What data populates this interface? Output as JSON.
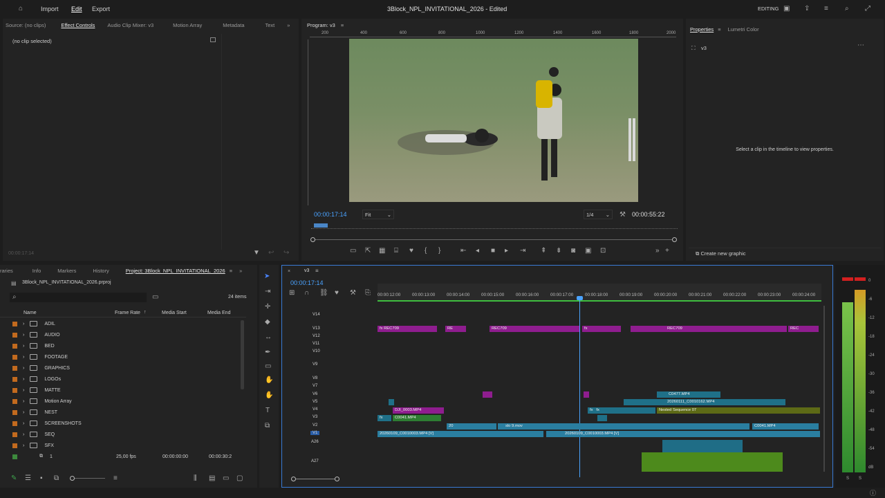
{
  "app": {
    "title": "3Block_NPL_INVITATIONAL_2026 - Edited",
    "menu": [
      "Import",
      "Edit",
      "Export"
    ],
    "mode": "EDITING"
  },
  "source_panel": {
    "tabs": [
      "Source: (no clips)",
      "Effect Controls",
      "Audio Clip Mixer: v3",
      "Motion Array",
      "Metadata",
      "Text"
    ],
    "no_clip": "(no clip selected)",
    "timecode": "00:00:17:14"
  },
  "program": {
    "tab": "Program: v3",
    "ruler": [
      "200",
      "400",
      "600",
      "800",
      "1000",
      "1200",
      "1400",
      "1600",
      "1800",
      "2000"
    ],
    "timecode": "00:00:17:14",
    "fit": "Fit",
    "quality": "1/4",
    "duration": "00:00:55:22"
  },
  "properties": {
    "tabs": [
      "Properties",
      "Lumetri Color"
    ],
    "sequence": "v3",
    "hint": "Select a clip in the timeline to view properties.",
    "create_button": "Create new graphic"
  },
  "project": {
    "tabs": [
      "raries",
      "Info",
      "Markers",
      "History",
      "Project: 3Block_NPL_INVITATIONAL_2026"
    ],
    "file": "3Block_NPL_INVITATIONAL_2026.prproj",
    "items": "24 items",
    "columns": [
      "Name",
      "Frame Rate",
      "Media Start",
      "Media End"
    ],
    "folders": [
      "ADIL",
      "AUDIO",
      "BED",
      "FOOTAGE",
      "GRAPHICS",
      "LOGOs",
      "MATTE",
      "Motion Array",
      "NEST",
      "SCREENSHOTS",
      "SEQ",
      "SFX"
    ],
    "seq_item": {
      "name": "1",
      "fps": "25,00 fps",
      "start": "00:00:00:00",
      "end": "00:00:30:2"
    }
  },
  "timeline": {
    "tab": "v3",
    "timecode": "00:00:17:14",
    "ruler": [
      "00:00:12:00",
      "00:00:13:00",
      "00:00:14:00",
      "00:00:15:00",
      "00:00:16:00",
      "00:00:17:00",
      "00:00:18:00",
      "00:00:19:00",
      "00:00:20:00",
      "00:00:21:00",
      "00:00:22:00",
      "00:00:23:00",
      "00:00:24:00"
    ],
    "tracks": [
      "V14",
      "V13",
      "V12",
      "V11",
      "V10",
      "V9",
      "V8",
      "V7",
      "V6",
      "V5",
      "V4",
      "V3",
      "V2",
      "V1",
      "A26",
      "A27"
    ],
    "clips": {
      "rec1": "REC709",
      "re": "RE",
      "rec2": "REC709",
      "rec3": "REC709",
      "rec4": "REC",
      "dji": "DJI_0003.MP4",
      "c0041a": "C0041.MP4",
      "c0477": "C0477.MP4",
      "c0010162": "20260111_C0010162.MP4",
      "nested": "Nested Sequence 07",
      "slo": "slo 9.mov",
      "two": "20",
      "c0041b": "C0041.MP4",
      "v1a": "20260109_C0010003.MP4 [V]",
      "v1b": "20260109_C0010003.MP4 [V]"
    }
  },
  "meter": {
    "scale": [
      "0",
      "-6",
      "-12",
      "-18",
      "-24",
      "-30",
      "-36",
      "-42",
      "-48",
      "-54",
      "dB"
    ],
    "labels": [
      "S",
      "S"
    ]
  }
}
